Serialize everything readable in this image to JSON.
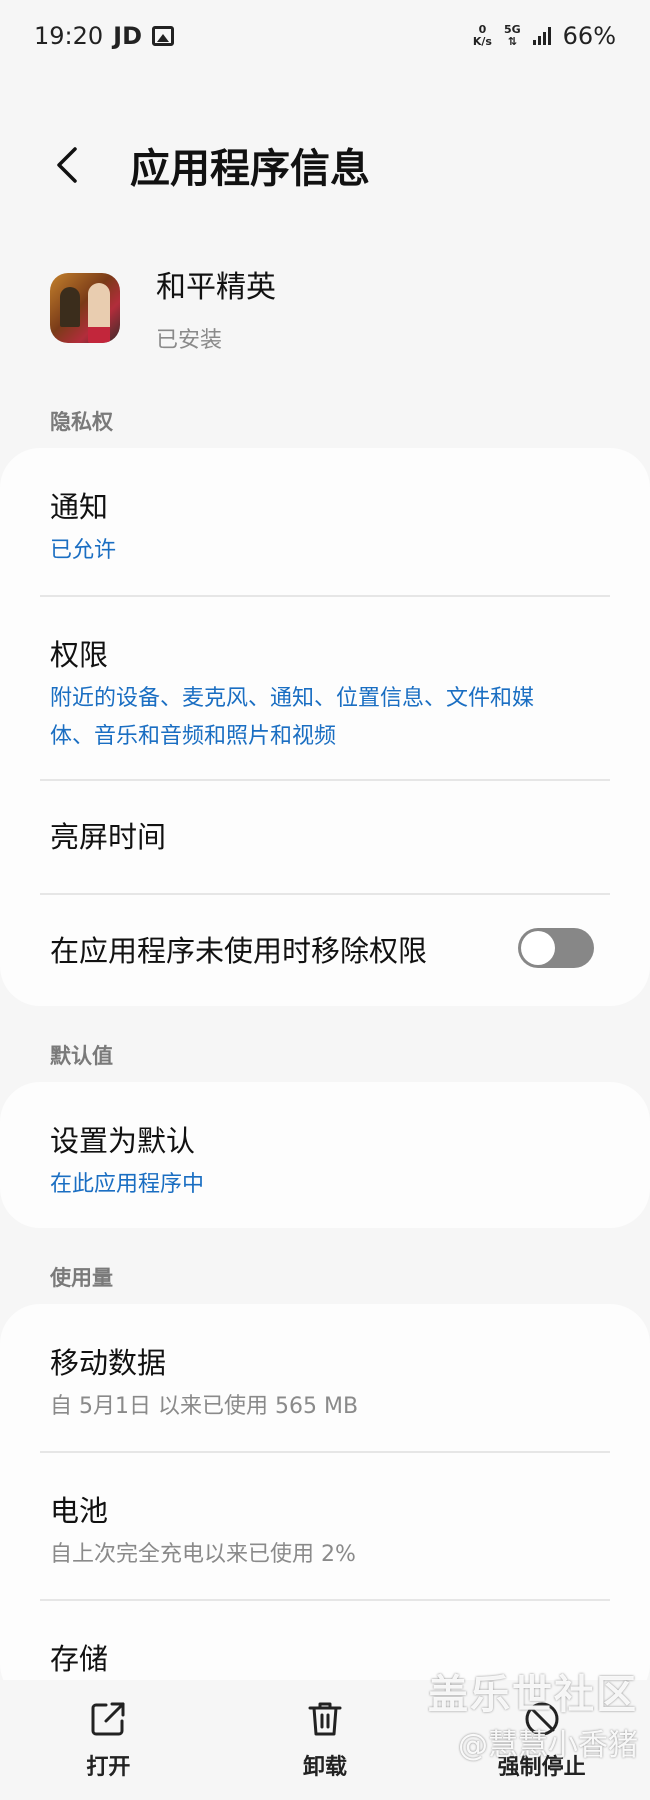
{
  "status_bar": {
    "time": "19:20",
    "carrier": "JD",
    "net_speed_value": "0",
    "net_speed_unit": "K/s",
    "network": "5G",
    "battery": "66%"
  },
  "header": {
    "title": "应用程序信息",
    "back_icon": "back-arrow-icon"
  },
  "app": {
    "name": "和平精英",
    "status": "已安装"
  },
  "sections": {
    "privacy": {
      "label": "隐私权",
      "notification": {
        "title": "通知",
        "value": "已允许"
      },
      "permissions": {
        "title": "权限",
        "value_line1": "附近的设备、麦克风、通知、位置信息、文件和媒",
        "value_line2": "体、音乐和音频和照片和视频"
      },
      "screen_time": {
        "title": "亮屏时间"
      },
      "remove_permissions": {
        "title": "在应用程序未使用时移除权限",
        "toggle_on": false
      }
    },
    "defaults": {
      "label": "默认值",
      "set_default": {
        "title": "设置为默认",
        "value": "在此应用程序中"
      }
    },
    "usage": {
      "label": "使用量",
      "mobile_data": {
        "title": "移动数据",
        "value": "自 5月1日 以来已使用 565 MB"
      },
      "battery": {
        "title": "电池",
        "value": "自上次完全充电以来已使用 2%"
      },
      "storage": {
        "title": "存储"
      }
    }
  },
  "bottom_bar": {
    "open": {
      "label": "打开",
      "icon": "open-external-icon"
    },
    "uninstall": {
      "label": "卸载",
      "icon": "trash-icon"
    },
    "force_stop": {
      "label": "强制停止",
      "icon": "force-stop-icon"
    }
  },
  "watermark": {
    "line1": "盖乐世社区",
    "line2": "@慧慧小香猪"
  },
  "colors": {
    "accent": "#1a6ec2",
    "background": "#f6f6f6",
    "card": "#fdfdfd"
  }
}
